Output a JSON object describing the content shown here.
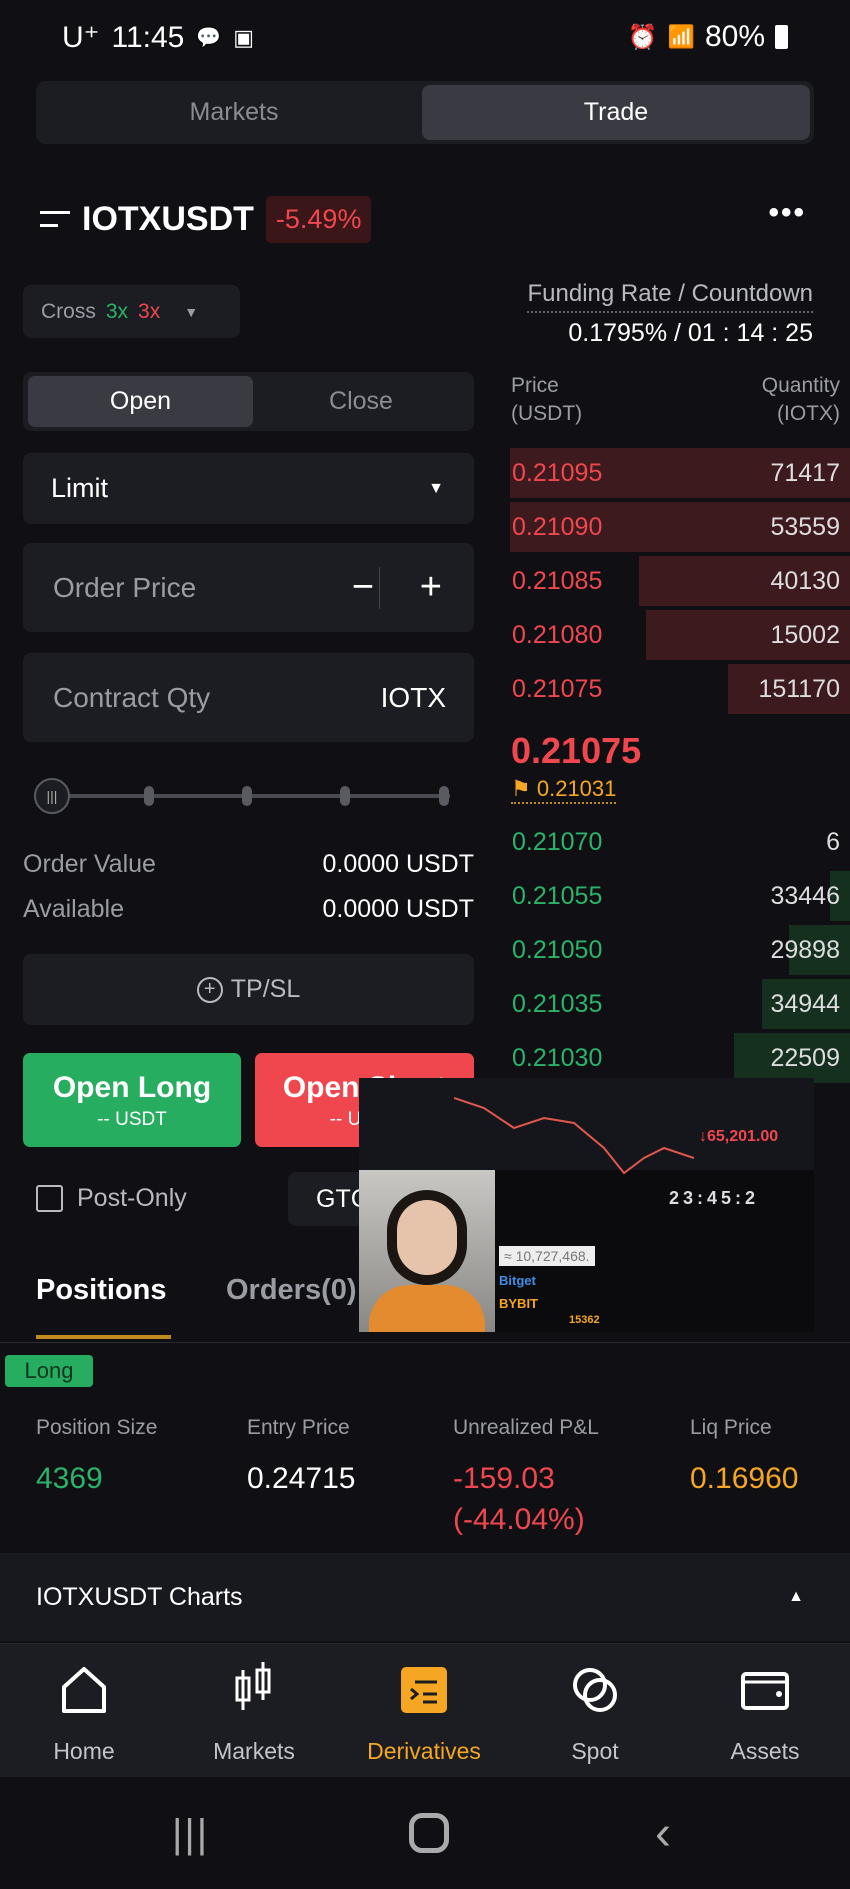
{
  "status_bar": {
    "carrier": "U⁺",
    "time": "11:45",
    "battery": "80%"
  },
  "top_tabs": [
    {
      "label": "Markets",
      "active": false
    },
    {
      "label": "Trade",
      "active": true
    }
  ],
  "header": {
    "symbol": "IOTXUSDT",
    "change": "-5.49%"
  },
  "margin": {
    "mode": "Cross",
    "long_leverage": "3x",
    "short_leverage": "3x"
  },
  "funding": {
    "label": "Funding Rate / Countdown",
    "value": "0.1795% / 01 : 14 : 25"
  },
  "order_form": {
    "tabs": [
      {
        "label": "Open",
        "active": true
      },
      {
        "label": "Close",
        "active": false
      }
    ],
    "order_type": "Limit",
    "price_placeholder": "Order Price",
    "qty_placeholder": "Contract Qty",
    "qty_unit": "IOTX",
    "slider_percent": 0,
    "order_value_label": "Order Value",
    "order_value": "0.0000 USDT",
    "available_label": "Available",
    "available": "0.0000 USDT",
    "tpsl_label": "TP/SL",
    "open_long": "Open Long",
    "open_long_sub": "-- USDT",
    "open_short": "Open Short",
    "open_short_sub": "-- USDT",
    "post_only": "Post-Only",
    "tif": "GTC"
  },
  "order_book": {
    "price_header": "Price",
    "price_unit": "(USDT)",
    "qty_header": "Quantity",
    "qty_unit": "(IOTX)",
    "asks": [
      {
        "price": "0.21095",
        "qty": "71417",
        "depth": 1.0
      },
      {
        "price": "0.21090",
        "qty": "53559",
        "depth": 1.0
      },
      {
        "price": "0.21085",
        "qty": "40130",
        "depth": 0.62
      },
      {
        "price": "0.21080",
        "qty": "15002",
        "depth": 0.6
      },
      {
        "price": "0.21075",
        "qty": "151170",
        "depth": 0.36
      }
    ],
    "last_price": "0.21075",
    "mark_price": "0.21031",
    "bids": [
      {
        "price": "0.21070",
        "qty": "6",
        "depth": 0
      },
      {
        "price": "0.21055",
        "qty": "33446",
        "depth": 0.06
      },
      {
        "price": "0.21050",
        "qty": "29898",
        "depth": 0.18
      },
      {
        "price": "0.21035",
        "qty": "34944",
        "depth": 0.26
      },
      {
        "price": "0.21030",
        "qty": "22509",
        "depth": 0.34
      }
    ]
  },
  "video_overlay": {
    "timer": "23:45:2",
    "price": "↓65,201.00",
    "balance": "≈ 10,727,468.",
    "brand1": "Bitget",
    "brand2": "BYBIT",
    "code": "15362"
  },
  "positions_tabs": [
    {
      "label": "Positions",
      "active": true
    },
    {
      "label": "Orders(0)",
      "active": false
    }
  ],
  "position": {
    "side": "Long",
    "headers": [
      "Position Size",
      "Entry Price",
      "Unrealized P&L",
      "Liq Price"
    ],
    "size": "4369",
    "entry": "0.24715",
    "pnl": "-159.03",
    "pnl_pct": "(-44.04%)",
    "liq": "0.16960"
  },
  "charts_label": "IOTXUSDT Charts",
  "bottom_nav": [
    {
      "label": "Home",
      "icon": "home-icon"
    },
    {
      "label": "Markets",
      "icon": "candlestick-icon"
    },
    {
      "label": "Derivatives",
      "icon": "derivatives-icon",
      "active": true
    },
    {
      "label": "Spot",
      "icon": "spot-icon"
    },
    {
      "label": "Assets",
      "icon": "wallet-icon"
    }
  ],
  "colors": {
    "bg": "#101014",
    "red": "#f0474f",
    "green": "#2bb36a",
    "accent": "#f5a623"
  }
}
